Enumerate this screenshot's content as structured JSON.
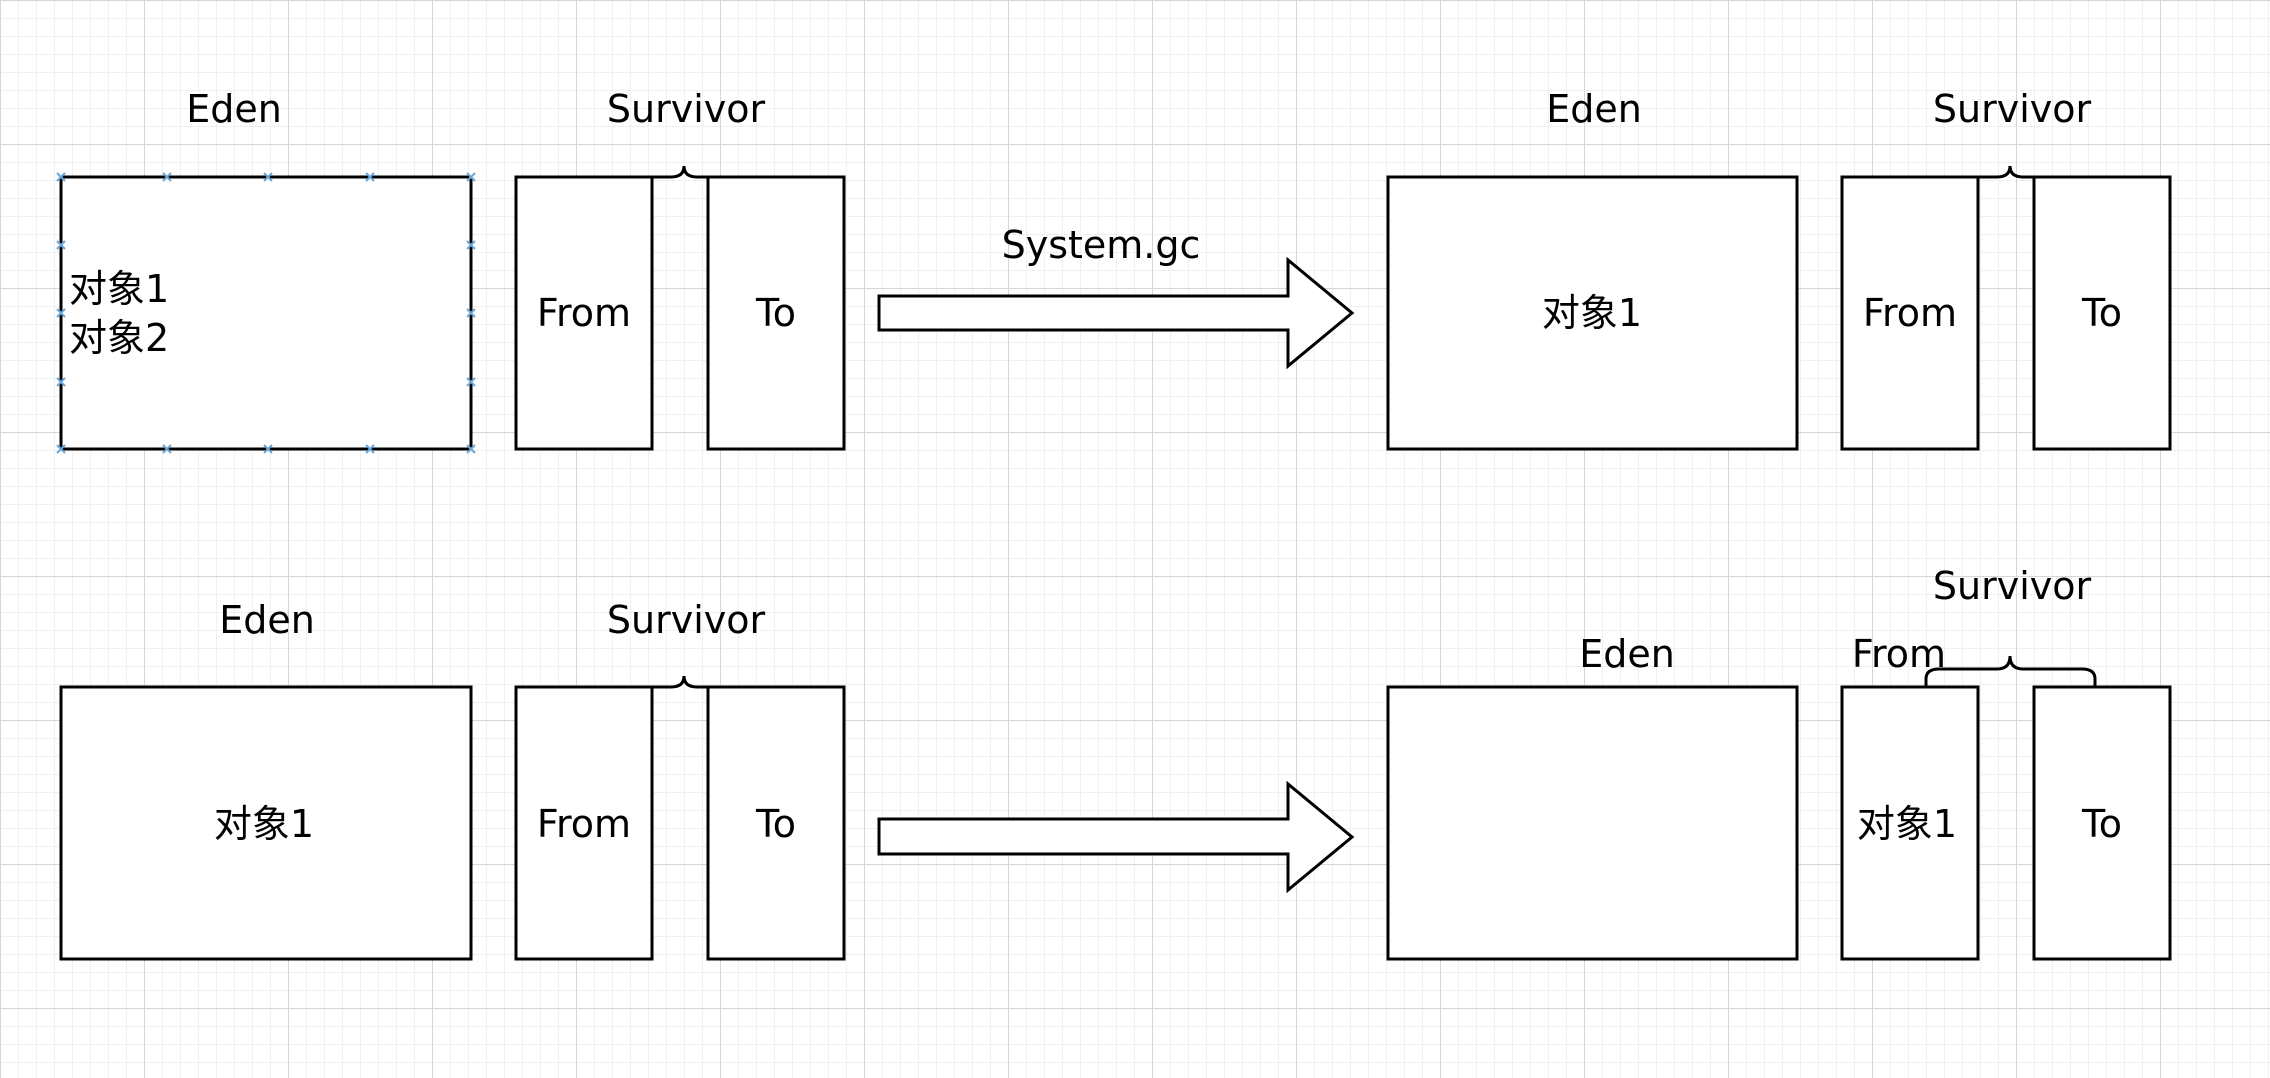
{
  "panels": {
    "top_left": {
      "eden_label": "Eden",
      "eden_lines": [
        "对象1",
        "对象2"
      ],
      "survivor_label": "Survivor",
      "from_label": "From",
      "to_label": "To"
    },
    "top_right": {
      "eden_label": "Eden",
      "eden_content": "对象1",
      "survivor_label": "Survivor",
      "from_label": "From",
      "to_label": "To"
    },
    "bottom_left": {
      "eden_label": "Eden",
      "eden_content": "对象1",
      "survivor_label": "Survivor",
      "from_label": "From",
      "to_label": "To"
    },
    "bottom_right": {
      "eden_label": "Eden",
      "survivor_label": "Survivor",
      "from_label": "From",
      "from_content": "对象1",
      "to_label": "To"
    }
  },
  "arrows": {
    "top": {
      "label": "System.gc"
    },
    "bottom": {
      "label": ""
    }
  },
  "colors": {
    "stroke": "#000000",
    "selection_handle": "#6aa6d8",
    "grid_major": "#d6d6d6",
    "grid_minor": "#f0f0f0"
  }
}
